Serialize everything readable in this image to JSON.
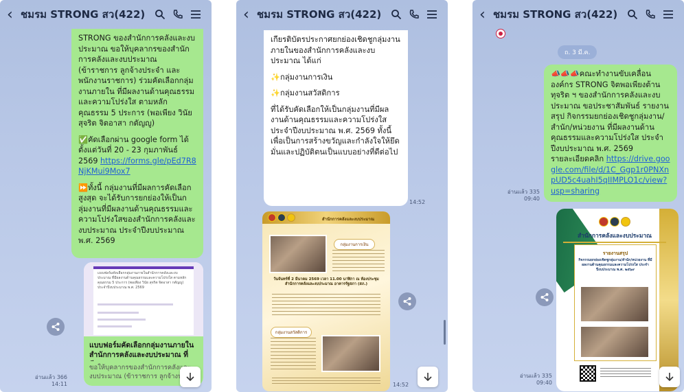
{
  "header": {
    "title": "ชมรม STRONG สว(422)"
  },
  "panel1": {
    "bubble_p1": "STRONG ของสำนักการคลังและงบประมาณ ขอให้บุคลากรของสำนักการคลังและงบประมาณ (ข้าราชการ ลูกจ้างประจำ และพนักงานราชการ) ร่วมคัดเลือกกลุ่มงานภายใน ที่มีผลงานด้านคุณธรรมและความโปร่งใส ตามหลักคุณธรรม 5 ประการ (พอเพียง วินัย สุจริต จิตอาสา กตัญญู)",
    "bubble_p2": "คัดเลือกผ่าน google form ได้ตั้งแต่วันที่ 20 - 23 กุมภาพันธ์ 2569",
    "bubble_link": "https://forms.gle/pEd7R8NjKMui9Mox7",
    "bubble_p3": "ทั้งนี้ กลุ่มงานที่มีผลการคัดเลือกสูงสุด จะได้รับการยกย่องให้เป็นกลุ่มงานที่มีผลงานด้านคุณธรรมและความโปร่งใสของสำนักการคลังและงบประมาณ ประจำปีงบประมาณ พ.ศ. 2569",
    "card_title": "แบบฟอร์มคัดเลือกกลุ่มงานภายในสำนักการคลังและงบประมาณ ที่มี...",
    "card_desc": "ขอให้บุคลากรของสำนักการคลังและงบประมาณ (ข้าราชการ ลูกจ้างประจำ แ...",
    "form_preview_text": "แบบฟอร์มคัดเลือกกลุ่มงานภายในสำนักการคลังและงบประมาณ ที่มีผลงานด้านคุณธรรมและความโปร่งใส ตามหลักคุณธรรม 5 ประการ (พอเพียง วินัย สุจริต จิตอาสา กตัญญู) ประจำปีงบประมาณ พ.ศ. 2569",
    "read_count": "อ่านแล้ว 366",
    "time": "14:11"
  },
  "panel2": {
    "bubble_top": "เกียรติบัตรประกาศยกย่องเชิดชูกลุ่มงานภายในของสำนักการคลังและงบประมาณ ได้แก่",
    "item1": "กลุ่มงานการเงิน",
    "item2": "กลุ่มงานสวัสดิการ",
    "bubble_bottom": "ที่ได้รับคัดเลือกให้เป็นกลุ่มงานที่มีผลงานด้านคุณธรรมและความโปร่งใส ประจำปีงบประมาณ พ.ศ. 2569 ทั้งนี้ เพื่อเป็นการสร้างขวัญและกำลังใจให้ยึดมั่นและปฏิบัติตนเป็นแบบอย่างที่ดีต่อไป",
    "time1": "14:52",
    "time2": "14:52",
    "poster_header": "สำนักการคลังและงบประมาณ",
    "poster_tag1": "กลุ่มงานการเงิน",
    "poster_tag2": "กลุ่มงานสวัสดิการ",
    "poster_event": "วันจันทร์ที่ 2 มีนาคม 2569 เวลา 11.00 นาฬิกา ณ ห้องประชุมสำนักการคลังและงบประมาณ อาคารรัฐสภา (สภ.)"
  },
  "panel3": {
    "sticker": "",
    "date_pill": "ถ. 3 มี.ค.",
    "bubble_text": "คณะทำงานขับเคลื่อนองค์กร STRONG จิตพอเพียงต้านทุจริต ฯ ของสำนักการคลังและงบประมาณ ขอประชาสัมพันธ์ รายงานสรุป กิจกรรมยกย่องเชิดชูกลุ่มงาน/สำนัก/หน่วยงาน ที่มีผลงานด้านคุณธรรมและความโปร่งใส ประจำปีงบประมาณ พ.ศ. 2569",
    "bubble_detail": "รายละเอียดคลิก",
    "bubble_link": "https://drive.google.com/file/d/1C_Ggp1r0PNXnpUD5c4uahI5qIIMPLO1c/view?usp=sharing",
    "read_count1": "อ่านแล้ว 335",
    "time1": "09:40",
    "read_count2": "อ่านแล้ว 335",
    "time2": "09:40",
    "report_header": "สำนักการคลังและงบประมาณ",
    "report_title": "รายงานสรุป",
    "report_subtitle": "กิจกรรมยกย่องเชิดชูกลุ่มงาน/สำนัก/หน่วยงาน ที่มีผลงานด้านคุณธรรมและความโปร่งใส ประจำปีงบประมาณ พ.ศ. ๒๕๖๙"
  },
  "colors": {
    "bubble_green": "#a6e88f",
    "chat_bg": "#b9c8e7",
    "link_blue": "#1f5fd6"
  }
}
